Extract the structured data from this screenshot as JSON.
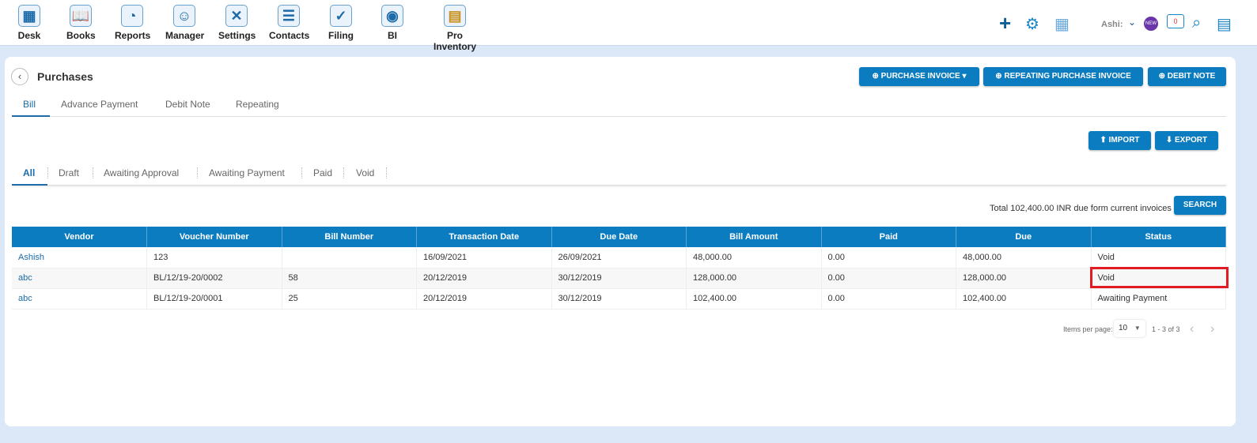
{
  "nav": [
    {
      "label": "Desk",
      "icon": "desk-icon"
    },
    {
      "label": "Books",
      "icon": "books-icon"
    },
    {
      "label": "Reports",
      "icon": "reports-icon"
    },
    {
      "label": "Manager",
      "icon": "manager-icon"
    },
    {
      "label": "Settings",
      "icon": "settings-icon"
    },
    {
      "label": "Contacts",
      "icon": "contacts-icon"
    },
    {
      "label": "Filing",
      "icon": "filing-icon"
    },
    {
      "label": "BI",
      "icon": "bi-icon"
    },
    {
      "label": "Pro Inventory",
      "icon": "pro-inventory-icon"
    }
  ],
  "header": {
    "user": "Ashi:",
    "notification_count": "0",
    "new_badge": "NEW"
  },
  "page": {
    "title": "Purchases",
    "purchase_invoice": "PURCHASE INVOICE",
    "repeating": "REPEATING PURCHASE INVOICE",
    "debit_note": "DEBIT NOTE",
    "import": "IMPORT",
    "export": "EXPORT",
    "search": "SEARCH",
    "total": "Total 102,400.00 INR due form current invoices"
  },
  "tabs": [
    "Bill",
    "Advance Payment",
    "Debit Note",
    "Repeating"
  ],
  "subtabs": [
    "All",
    "Draft",
    "Awaiting Approval",
    "Awaiting Payment",
    "Paid",
    "Void"
  ],
  "table": {
    "headers": [
      "Vendor",
      "Voucher Number",
      "Bill Number",
      "Transaction Date",
      "Due Date",
      "Bill Amount",
      "Paid",
      "Due",
      "Status"
    ],
    "rows": [
      [
        "Ashish",
        "123",
        "",
        "16/09/2021",
        "26/09/2021",
        "48,000.00",
        "0.00",
        "48,000.00",
        "Void"
      ],
      [
        "abc",
        "BL/12/19-20/0002",
        "58",
        "20/12/2019",
        "30/12/2019",
        "128,000.00",
        "0.00",
        "128,000.00",
        "Void"
      ],
      [
        "abc",
        "BL/12/19-20/0001",
        "25",
        "20/12/2019",
        "30/12/2019",
        "102,400.00",
        "0.00",
        "102,400.00",
        "Awaiting Payment"
      ]
    ]
  },
  "pagination": {
    "label": "Items per page:",
    "size": "10",
    "range": "1 - 3 of 3"
  },
  "colors": {
    "accent": "#0c7cc1",
    "highlight": "#e01b24"
  }
}
